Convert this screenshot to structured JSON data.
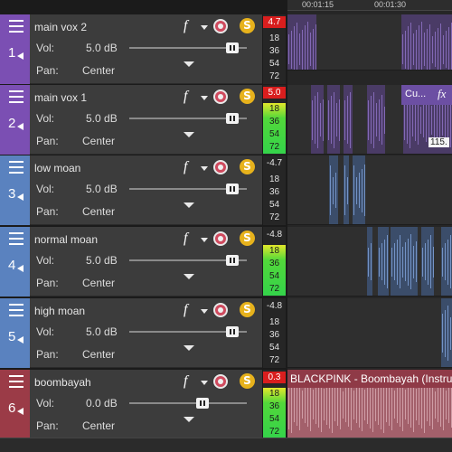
{
  "tracks": [
    {
      "number": "1",
      "name": "main vox 2",
      "vol_label": "Vol:",
      "vol_value": "5.0 dB",
      "pan_label": "Pan:",
      "pan_value": "Center",
      "color": "#7b4fb3",
      "peak": "4.7",
      "peak_hot": true,
      "meter_lit": false,
      "scale": [
        "18",
        "36",
        "54",
        "72"
      ],
      "vol_fraction": 0.88
    },
    {
      "number": "2",
      "name": "main vox 1",
      "vol_label": "Vol:",
      "vol_value": "5.0 dB",
      "pan_label": "Pan:",
      "pan_value": "Center",
      "color": "#7b4fb3",
      "peak": "5.0",
      "peak_hot": true,
      "meter_lit": true,
      "scale": [
        "18",
        "36",
        "54",
        "72"
      ],
      "vol_fraction": 0.88
    },
    {
      "number": "3",
      "name": "low moan",
      "vol_label": "Vol:",
      "vol_value": "5.0 dB",
      "pan_label": "Pan:",
      "pan_value": "Center",
      "color": "#5a82bf",
      "peak": "-4.7",
      "peak_hot": false,
      "meter_lit": false,
      "scale": [
        "18",
        "36",
        "54",
        "72"
      ],
      "vol_fraction": 0.88
    },
    {
      "number": "4",
      "name": "normal moan",
      "vol_label": "Vol:",
      "vol_value": "5.0 dB",
      "pan_label": "Pan:",
      "pan_value": "Center",
      "color": "#5a82bf",
      "peak": "-4.8",
      "peak_hot": false,
      "meter_lit": true,
      "scale": [
        "18",
        "36",
        "54",
        "72"
      ],
      "vol_fraction": 0.88
    },
    {
      "number": "5",
      "name": "high moan",
      "vol_label": "Vol:",
      "vol_value": "5.0 dB",
      "pan_label": "Pan:",
      "pan_value": "Center",
      "color": "#5a82bf",
      "peak": "-4.8",
      "peak_hot": false,
      "meter_lit": false,
      "scale": [
        "18",
        "36",
        "54",
        "72"
      ],
      "vol_fraction": 0.88
    },
    {
      "number": "6",
      "name": "boombayah",
      "vol_label": "Vol:",
      "vol_value": "0.0 dB",
      "pan_label": "Pan:",
      "pan_value": "Center",
      "color": "#9b3b47",
      "peak": "0.3",
      "peak_hot": true,
      "meter_lit": true,
      "scale": [
        "18",
        "36",
        "54",
        "72"
      ],
      "vol_fraction": 0.62
    }
  ],
  "icons": {
    "fx": "fx-icon",
    "automation": "automation-icon",
    "solo": "solo-icon",
    "menu": "menu-icon"
  },
  "fx_symbol": "f",
  "solo_symbol": "S",
  "ruler": {
    "time_1": "00:01:15",
    "time_2": "00:01:30"
  },
  "clips": {
    "track2_title": "Cu...",
    "track2_fx": "fx",
    "track2_tooltip": "115.",
    "track6_title": "BLACKPINK - Boombayah (Instru"
  },
  "colors": {
    "purple": "#7b4fb3",
    "blue": "#5a82bf",
    "red": "#9b3b47",
    "meter_peak": "#d91e1e"
  }
}
